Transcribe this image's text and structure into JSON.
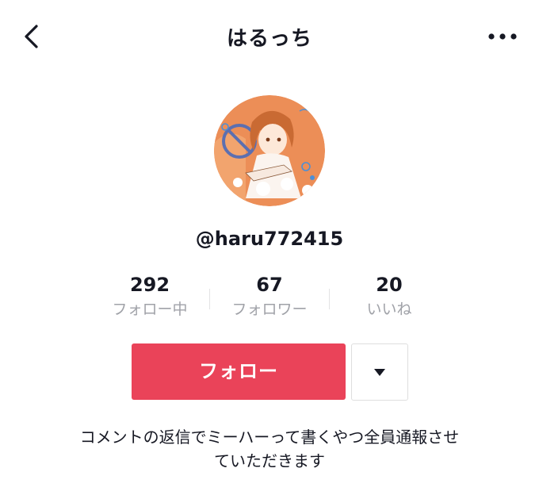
{
  "header": {
    "title": "はるっち",
    "back_icon": "chevron-left-icon",
    "more_icon": "more-horizontal-icon"
  },
  "profile": {
    "username": "@haru772415",
    "avatar_icon": "avatar-illustration",
    "stats": [
      {
        "value": "292",
        "label": "フォロー中"
      },
      {
        "value": "67",
        "label": "フォロワー"
      },
      {
        "value": "20",
        "label": "いいね"
      }
    ],
    "follow_label": "フォロー",
    "dropdown_icon": "caret-down-icon",
    "bio_line1": "コメントの返信でミーハーって書くやつ全員通報させ",
    "bio_line2": "ていただきます"
  },
  "colors": {
    "accent": "#ea4359",
    "text": "#161823",
    "muted": "#a0a2a8"
  }
}
